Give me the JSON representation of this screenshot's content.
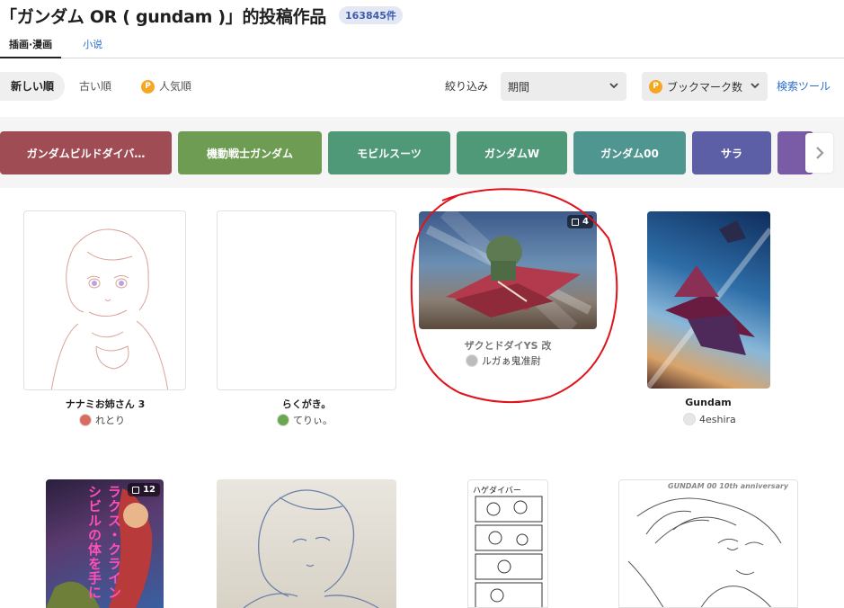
{
  "header": {
    "title": "「ガンダム OR ( gundam )」的投稿作品",
    "count_badge": "163845件"
  },
  "tabs": [
    {
      "label": "插画·漫画",
      "active": true
    },
    {
      "label": "小说",
      "active": false
    }
  ],
  "sort": {
    "newest": "新しい順",
    "oldest": "古い順",
    "popular": "人気順",
    "filter_label": "絞り込み",
    "period_select": "期間",
    "bookmark_select": "ブックマーク数",
    "search_tools": "検索ツール",
    "premium_icon": "P"
  },
  "tags": [
    {
      "label": "ガンダムビルドダイバ…",
      "color": "#a04c55"
    },
    {
      "label": "機動戦士ガンダム",
      "color": "#6e9c52"
    },
    {
      "label": "モビルスーツ",
      "color": "#4f9878"
    },
    {
      "label": "ガンダムW",
      "color": "#4f9878"
    },
    {
      "label": "ガンダム00",
      "color": "#4f9590"
    },
    {
      "label": "サラ",
      "color": "#5c5fa6"
    },
    {
      "label": "",
      "color": "#7a5ba5"
    }
  ],
  "works": [
    {
      "title": "ナナミお姉さん 3",
      "author": "れとり",
      "page_count": ""
    },
    {
      "title": "らくがき。",
      "author": "てりぃ。",
      "page_count": ""
    },
    {
      "title": "ザクとドダイYS 改",
      "author": "ルガぁ鬼准尉",
      "page_count": "4"
    },
    {
      "title": "Gundam",
      "author": "4eshira",
      "page_count": ""
    },
    {
      "title": "",
      "author": "",
      "page_count": "12"
    },
    {
      "title": "",
      "author": "",
      "page_count": ""
    },
    {
      "title": "",
      "author": "",
      "page_count": ""
    },
    {
      "title": "",
      "author": "",
      "page_count": ""
    }
  ],
  "thumbnail_text": {
    "cover_line1": "シビルの体を手に",
    "cover_line2": "ラクス・クライン",
    "gundam00_banner": "GUNDAM 00 10th anniversary",
    "comic_header": "ハゲダイバー"
  },
  "colors": {
    "link_blue": "#2b6fd0",
    "badge_blue": "#3d5cae",
    "annotation_red": "#e0131b"
  }
}
